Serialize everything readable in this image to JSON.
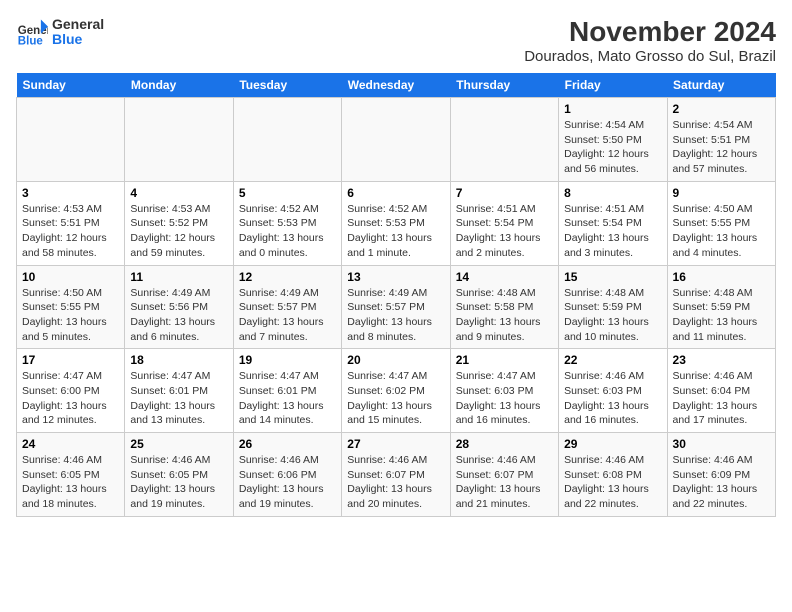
{
  "logo": {
    "text_general": "General",
    "text_blue": "Blue"
  },
  "title": "November 2024",
  "subtitle": "Dourados, Mato Grosso do Sul, Brazil",
  "weekdays": [
    "Sunday",
    "Monday",
    "Tuesday",
    "Wednesday",
    "Thursday",
    "Friday",
    "Saturday"
  ],
  "weeks": [
    [
      {
        "day": "",
        "info": ""
      },
      {
        "day": "",
        "info": ""
      },
      {
        "day": "",
        "info": ""
      },
      {
        "day": "",
        "info": ""
      },
      {
        "day": "",
        "info": ""
      },
      {
        "day": "1",
        "info": "Sunrise: 4:54 AM\nSunset: 5:50 PM\nDaylight: 12 hours and 56 minutes."
      },
      {
        "day": "2",
        "info": "Sunrise: 4:54 AM\nSunset: 5:51 PM\nDaylight: 12 hours and 57 minutes."
      }
    ],
    [
      {
        "day": "3",
        "info": "Sunrise: 4:53 AM\nSunset: 5:51 PM\nDaylight: 12 hours and 58 minutes."
      },
      {
        "day": "4",
        "info": "Sunrise: 4:53 AM\nSunset: 5:52 PM\nDaylight: 12 hours and 59 minutes."
      },
      {
        "day": "5",
        "info": "Sunrise: 4:52 AM\nSunset: 5:53 PM\nDaylight: 13 hours and 0 minutes."
      },
      {
        "day": "6",
        "info": "Sunrise: 4:52 AM\nSunset: 5:53 PM\nDaylight: 13 hours and 1 minute."
      },
      {
        "day": "7",
        "info": "Sunrise: 4:51 AM\nSunset: 5:54 PM\nDaylight: 13 hours and 2 minutes."
      },
      {
        "day": "8",
        "info": "Sunrise: 4:51 AM\nSunset: 5:54 PM\nDaylight: 13 hours and 3 minutes."
      },
      {
        "day": "9",
        "info": "Sunrise: 4:50 AM\nSunset: 5:55 PM\nDaylight: 13 hours and 4 minutes."
      }
    ],
    [
      {
        "day": "10",
        "info": "Sunrise: 4:50 AM\nSunset: 5:55 PM\nDaylight: 13 hours and 5 minutes."
      },
      {
        "day": "11",
        "info": "Sunrise: 4:49 AM\nSunset: 5:56 PM\nDaylight: 13 hours and 6 minutes."
      },
      {
        "day": "12",
        "info": "Sunrise: 4:49 AM\nSunset: 5:57 PM\nDaylight: 13 hours and 7 minutes."
      },
      {
        "day": "13",
        "info": "Sunrise: 4:49 AM\nSunset: 5:57 PM\nDaylight: 13 hours and 8 minutes."
      },
      {
        "day": "14",
        "info": "Sunrise: 4:48 AM\nSunset: 5:58 PM\nDaylight: 13 hours and 9 minutes."
      },
      {
        "day": "15",
        "info": "Sunrise: 4:48 AM\nSunset: 5:59 PM\nDaylight: 13 hours and 10 minutes."
      },
      {
        "day": "16",
        "info": "Sunrise: 4:48 AM\nSunset: 5:59 PM\nDaylight: 13 hours and 11 minutes."
      }
    ],
    [
      {
        "day": "17",
        "info": "Sunrise: 4:47 AM\nSunset: 6:00 PM\nDaylight: 13 hours and 12 minutes."
      },
      {
        "day": "18",
        "info": "Sunrise: 4:47 AM\nSunset: 6:01 PM\nDaylight: 13 hours and 13 minutes."
      },
      {
        "day": "19",
        "info": "Sunrise: 4:47 AM\nSunset: 6:01 PM\nDaylight: 13 hours and 14 minutes."
      },
      {
        "day": "20",
        "info": "Sunrise: 4:47 AM\nSunset: 6:02 PM\nDaylight: 13 hours and 15 minutes."
      },
      {
        "day": "21",
        "info": "Sunrise: 4:47 AM\nSunset: 6:03 PM\nDaylight: 13 hours and 16 minutes."
      },
      {
        "day": "22",
        "info": "Sunrise: 4:46 AM\nSunset: 6:03 PM\nDaylight: 13 hours and 16 minutes."
      },
      {
        "day": "23",
        "info": "Sunrise: 4:46 AM\nSunset: 6:04 PM\nDaylight: 13 hours and 17 minutes."
      }
    ],
    [
      {
        "day": "24",
        "info": "Sunrise: 4:46 AM\nSunset: 6:05 PM\nDaylight: 13 hours and 18 minutes."
      },
      {
        "day": "25",
        "info": "Sunrise: 4:46 AM\nSunset: 6:05 PM\nDaylight: 13 hours and 19 minutes."
      },
      {
        "day": "26",
        "info": "Sunrise: 4:46 AM\nSunset: 6:06 PM\nDaylight: 13 hours and 19 minutes."
      },
      {
        "day": "27",
        "info": "Sunrise: 4:46 AM\nSunset: 6:07 PM\nDaylight: 13 hours and 20 minutes."
      },
      {
        "day": "28",
        "info": "Sunrise: 4:46 AM\nSunset: 6:07 PM\nDaylight: 13 hours and 21 minutes."
      },
      {
        "day": "29",
        "info": "Sunrise: 4:46 AM\nSunset: 6:08 PM\nDaylight: 13 hours and 22 minutes."
      },
      {
        "day": "30",
        "info": "Sunrise: 4:46 AM\nSunset: 6:09 PM\nDaylight: 13 hours and 22 minutes."
      }
    ]
  ]
}
